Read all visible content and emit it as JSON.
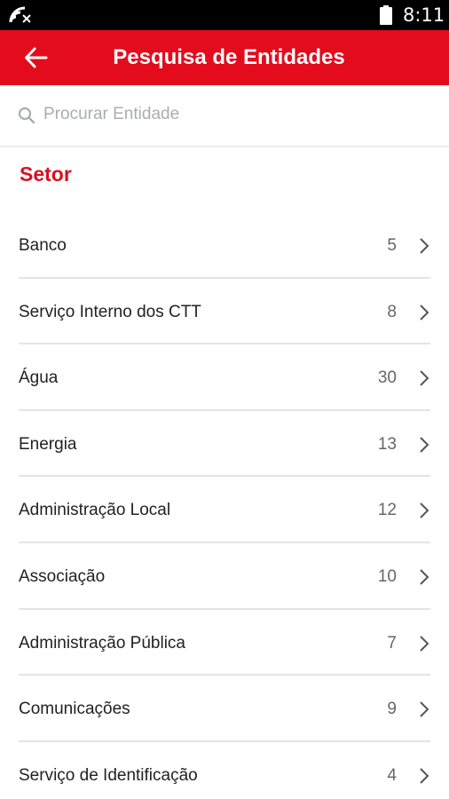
{
  "status_bar": {
    "time": "8:11",
    "icons": [
      "wifi-icon",
      "battery-icon"
    ]
  },
  "app_bar": {
    "title": "Pesquisa de Entidades",
    "back_icon": "arrow-left-icon",
    "color": "#e30b1c"
  },
  "search": {
    "placeholder": "Procurar Entidade",
    "value": "",
    "icon": "search-icon"
  },
  "section": {
    "title": "Setor",
    "color": "#d8111f"
  },
  "sectors": [
    {
      "label": "Banco",
      "count": "5"
    },
    {
      "label": "Serviço Interno dos CTT",
      "count": "8"
    },
    {
      "label": "Água",
      "count": "30"
    },
    {
      "label": "Energia",
      "count": "13"
    },
    {
      "label": "Administração Local",
      "count": "12"
    },
    {
      "label": "Associação",
      "count": "10"
    },
    {
      "label": "Administração Pública",
      "count": "7"
    },
    {
      "label": "Comunicações",
      "count": "9"
    },
    {
      "label": "Serviço de Identificação",
      "count": "4"
    }
  ]
}
